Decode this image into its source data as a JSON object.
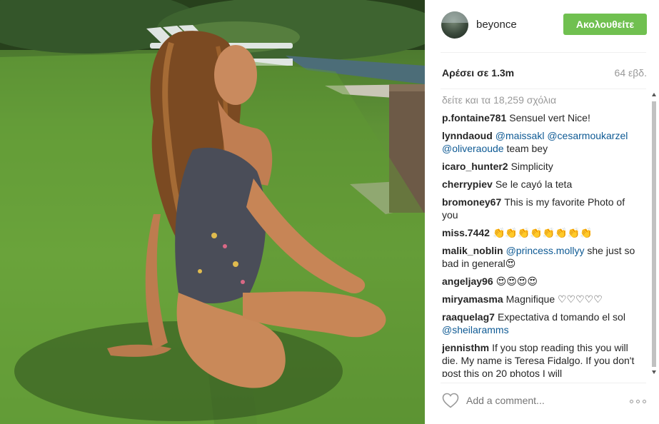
{
  "post": {
    "username": "beyonce",
    "follow_label": "Ακολουθείτε",
    "likes": "Αρέσει σε 1.3m",
    "age": "64 εβδ.",
    "view_all": "δείτε και τα 18,259 σχόλια",
    "add_comment_placeholder": "Add a comment...",
    "accent_color": "#70c050"
  },
  "comments": [
    {
      "user": "p.fontaine781",
      "text": "Sensuel vert Nice!"
    },
    {
      "user": "lynndaoud",
      "mentions": [
        "@maissakl",
        "@cesarmoukarzel",
        "@oliveraoude"
      ],
      "text": " team bey"
    },
    {
      "user": "icaro_hunter2",
      "text": "Simplicity"
    },
    {
      "user": "cherrypiev",
      "text": "Se le cayó la teta"
    },
    {
      "user": "bromoney67",
      "text": "This is my favorite Photo of you"
    },
    {
      "user": "miss.7442",
      "text": "👏👏👏👏👏👏👏👏"
    },
    {
      "user": "malik_noblin",
      "mention": "@princess.mollyy",
      "text": " she just so bad in general😍"
    },
    {
      "user": "angeljay96",
      "text": "😍😍😍😍"
    },
    {
      "user": "miryamasma",
      "text": "Magnifique ♡♡♡♡♡"
    },
    {
      "user": "raaquelag7",
      "text": "Expectativa d tomando el sol ",
      "mention": "@sheilaramms"
    },
    {
      "user": "jennisthm",
      "text": "If you stop reading this you will die. My name is Teresa Fidalgo. If you don't post this on 20 photos I will"
    }
  ],
  "icons": {
    "heart": "heart-icon",
    "more": "more-options-icon",
    "avatar": "profile-avatar"
  }
}
